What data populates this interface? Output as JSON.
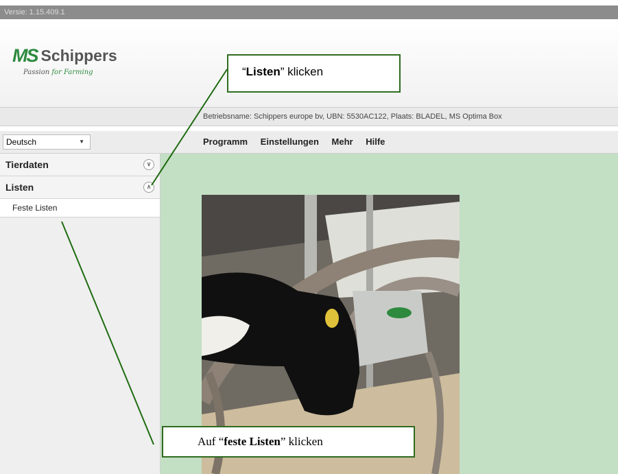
{
  "version_label": "Versie: 1.15.409.1",
  "logo": {
    "mark": "MS",
    "name": "Schippers",
    "tagline_start": "Passion ",
    "tagline_highlight": "for Farming",
    "brand_color": "#2d8a3e"
  },
  "info_text": "Betriebsname: Schippers europe bv, UBN: 5530AC122, Plaats: BLADEL, MS Optima Box",
  "language": {
    "selected": "Deutsch"
  },
  "menu": [
    "Programm",
    "Einstellungen",
    "Mehr",
    "Hilfe"
  ],
  "sidebar": {
    "sections": [
      {
        "label": "Tierdaten",
        "state": "collapsed"
      },
      {
        "label": "Listen",
        "state": "expanded",
        "items": [
          {
            "label": "Feste Listen"
          }
        ]
      }
    ]
  },
  "callouts": {
    "top": {
      "q1": "“",
      "bold": "Listen",
      "q2": "”",
      "rest": " klicken"
    },
    "bottom": {
      "pre": "Auf “",
      "bold": "feste Listen",
      "post": "” klicken"
    }
  },
  "colors": {
    "content_bg": "#c3dfc4",
    "callout_border": "#2e6b1f",
    "arrow": "#1e6b10"
  }
}
